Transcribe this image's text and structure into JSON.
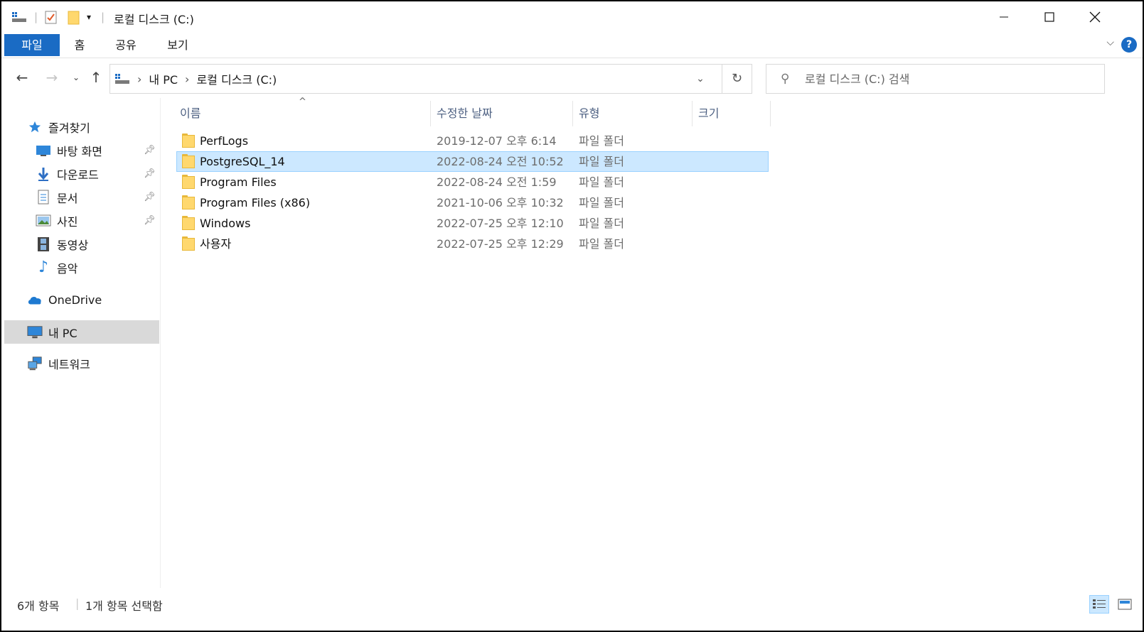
{
  "window": {
    "title": "로컬 디스크 (C:)",
    "minimize_icon": "minimize-icon",
    "maximize_icon": "maximize-icon",
    "close_icon": "close-icon"
  },
  "ribbon": {
    "tabs": [
      "파일",
      "홈",
      "공유",
      "보기"
    ],
    "accent": "#1a6bc4"
  },
  "address": {
    "crumbs": [
      "내 PC",
      "로컬 디스크 (C:)"
    ]
  },
  "search": {
    "placeholder": "로컬 디스크 (C:) 검색"
  },
  "sidebar": {
    "quick_access": "즐겨찾기",
    "items": [
      {
        "label": "바탕 화면",
        "icon": "desktop-icon",
        "pinned": true
      },
      {
        "label": "다운로드",
        "icon": "download-icon",
        "pinned": true
      },
      {
        "label": "문서",
        "icon": "document-icon",
        "pinned": true
      },
      {
        "label": "사진",
        "icon": "pictures-icon",
        "pinned": true
      },
      {
        "label": "동영상",
        "icon": "video-icon",
        "pinned": false
      },
      {
        "label": "음악",
        "icon": "music-icon",
        "pinned": false
      }
    ],
    "onedrive": "OneDrive",
    "this_pc": "내 PC",
    "network": "네트워크"
  },
  "columns": {
    "name": "이름",
    "date": "수정한 날짜",
    "type": "유형",
    "size": "크기"
  },
  "files": [
    {
      "name": "PerfLogs",
      "date": "2019-12-07 오후 6:14",
      "type": "파일 폴더",
      "selected": false
    },
    {
      "name": "PostgreSQL_14",
      "date": "2022-08-24 오전 10:52",
      "type": "파일 폴더",
      "selected": true
    },
    {
      "name": "Program Files",
      "date": "2022-08-24 오전 1:59",
      "type": "파일 폴더",
      "selected": false
    },
    {
      "name": "Program Files (x86)",
      "date": "2021-10-06 오후 10:32",
      "type": "파일 폴더",
      "selected": false
    },
    {
      "name": "Windows",
      "date": "2022-07-25 오후 12:10",
      "type": "파일 폴더",
      "selected": false
    },
    {
      "name": "사용자",
      "date": "2022-07-25 오후 12:29",
      "type": "파일 폴더",
      "selected": false
    }
  ],
  "status": {
    "count": "6개 항목",
    "selection": "1개 항목 선택함"
  }
}
